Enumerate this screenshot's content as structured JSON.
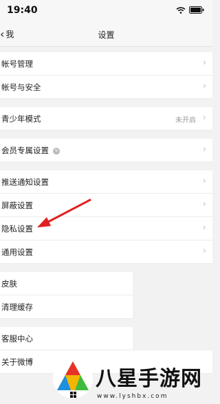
{
  "status": {
    "time": "19:40"
  },
  "nav": {
    "back_label": "我",
    "title": "设置"
  },
  "sections": {
    "account": [
      {
        "label": "帐号管理"
      },
      {
        "label": "帐号与安全"
      }
    ],
    "youth": {
      "label": "青少年模式",
      "value": "未开启"
    },
    "member": {
      "label": "会员专属设置"
    },
    "general": [
      {
        "label": "推送通知设置"
      },
      {
        "label": "屏蔽设置"
      },
      {
        "label": "隐私设置"
      },
      {
        "label": "通用设置"
      }
    ],
    "display": [
      {
        "label": "皮肤"
      },
      {
        "label": "清理缓存"
      }
    ],
    "help": [
      {
        "label": "客服中心"
      },
      {
        "label": "关于微博"
      }
    ]
  },
  "watermark": {
    "brand": "八星手游网",
    "url": "www.lyshbx.com"
  },
  "colors": {
    "annotation_arrow": "#e02020"
  }
}
